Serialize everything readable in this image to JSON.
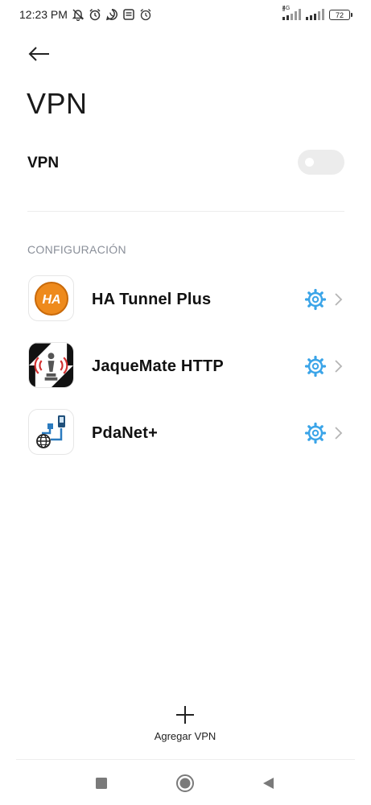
{
  "status_bar": {
    "time": "12:23 PM",
    "network_label": "4G",
    "battery_level": "72",
    "icons": [
      "muted-bell-icon",
      "alarm-icon",
      "whatsapp-icon",
      "message-icon",
      "alarm-icon"
    ]
  },
  "header": {
    "title": "VPN"
  },
  "vpn_toggle": {
    "label": "VPN",
    "enabled": false
  },
  "section": {
    "header": "CONFIGURACIÓN"
  },
  "vpn_list": [
    {
      "name": "HA Tunnel Plus",
      "icon": "ha-tunnel-plus-icon"
    },
    {
      "name": "JaqueMate HTTP",
      "icon": "jaquemate-http-icon"
    },
    {
      "name": "PdaNet+",
      "icon": "pdanet-icon"
    }
  ],
  "add_vpn": {
    "label": "Agregar VPN"
  },
  "colors": {
    "accent": "#3aa4e8",
    "ha_orange": "#ee8a1c",
    "toggle_off": "#ececec",
    "section_gray": "#8a8f99"
  }
}
